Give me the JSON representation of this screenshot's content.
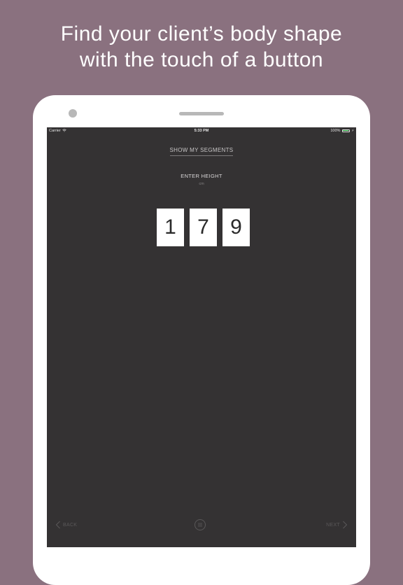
{
  "promo": {
    "headline_line1": "Find your client’s body shape",
    "headline_line2": "with the touch of a button"
  },
  "status_bar": {
    "carrier": "Carrier",
    "time": "5:33 PM",
    "battery": "100%",
    "icons": [
      "wifi-icon",
      "battery-icon",
      "charge-icon"
    ],
    "battery_color": "#4cd964"
  },
  "screen": {
    "segments_link": "SHOW MY SEGMENTS",
    "title": "ENTER HEIGHT",
    "unit": "cm",
    "digits": [
      "1",
      "7",
      "9"
    ]
  },
  "nav": {
    "back_label": "BACK",
    "next_label": "NEXT",
    "icons": [
      "chevron-left-icon",
      "menu-icon",
      "chevron-right-icon"
    ]
  },
  "colors": {
    "background": "#8a717f",
    "screen": "#343233",
    "device": "#ffffff"
  }
}
